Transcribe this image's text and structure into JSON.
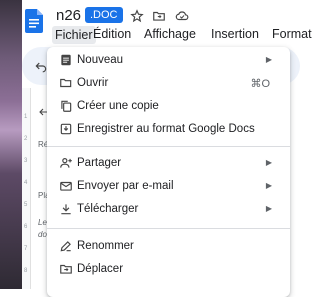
{
  "document": {
    "title": "n26",
    "extension": ".DOC"
  },
  "menubar": [
    "Fichier",
    "Édition",
    "Affichage",
    "Insertion",
    "Format"
  ],
  "background": {
    "line1": "Ré",
    "line2": "Pla",
    "line3": "Le",
    "line4": "do"
  },
  "menu": {
    "items": [
      {
        "label": "Nouveau",
        "icon": "document-icon",
        "submenu": true
      },
      {
        "label": "Ouvrir",
        "icon": "folder-open-icon",
        "shortcut": "⌘O"
      },
      {
        "label": "Créer une copie",
        "icon": "copy-icon"
      },
      {
        "label": "Enregistrer au format Google Docs",
        "icon": "save-icon"
      },
      {
        "label": "Partager",
        "icon": "person-add-icon",
        "submenu": true
      },
      {
        "label": "Envoyer par e-mail",
        "icon": "email-icon",
        "submenu": true
      },
      {
        "label": "Télécharger",
        "icon": "download-icon",
        "submenu": true
      },
      {
        "label": "Renommer",
        "icon": "rename-icon"
      },
      {
        "label": "Déplacer",
        "icon": "move-icon"
      }
    ]
  },
  "colors": {
    "accent": "#1a73e8",
    "menu_highlight": "#e8eaed",
    "toolbar": "#edf2fa"
  }
}
